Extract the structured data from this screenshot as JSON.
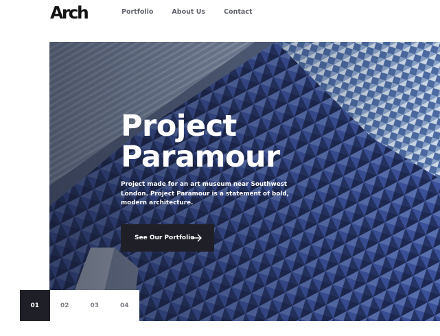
{
  "header": {
    "logo": "Arch",
    "nav": [
      "Portfolio",
      "About Us",
      "Contact"
    ]
  },
  "hero": {
    "title_line1": "Project",
    "title_line2": "Paramour",
    "description": "Project made for an art museum near Southwest London. Project Paramour is a statement of bold, modern architecture.",
    "cta_label": "See Our Portfolio"
  },
  "pagination": {
    "pages": [
      "01",
      "02",
      "03",
      "04"
    ],
    "active": "01"
  },
  "colors": {
    "dark": "#1f2027",
    "nav_text": "#62646d",
    "facade_blue": "#34457a"
  },
  "icons": {
    "cta": "arrow-right-icon"
  }
}
